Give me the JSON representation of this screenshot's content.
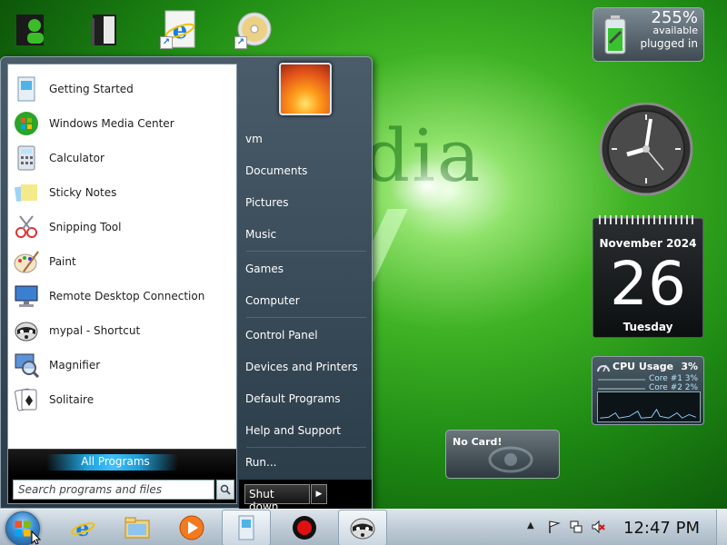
{
  "desktop": {
    "wallpaper_text": "dia",
    "icons": [
      {
        "name": "user-folder-icon"
      },
      {
        "name": "documents-folder-icon"
      },
      {
        "name": "internet-explorer-icon"
      },
      {
        "name": "dvd-drive-icon"
      }
    ]
  },
  "gadgets": {
    "battery": {
      "percent": "255%",
      "status": "available",
      "power": "plugged in"
    },
    "calendar": {
      "month": "November 2024",
      "day": "26",
      "weekday": "Tuesday"
    },
    "cpu": {
      "title": "CPU Usage",
      "total": "3%",
      "cores": [
        {
          "name": "Core #1",
          "value": "3%"
        },
        {
          "name": "Core #2",
          "value": "2%"
        }
      ]
    },
    "card": {
      "label": "No Card!"
    }
  },
  "start_menu": {
    "programs": [
      {
        "label": "Getting Started",
        "icon": "getting-started-icon"
      },
      {
        "label": "Windows Media Center",
        "icon": "media-center-icon"
      },
      {
        "label": "Calculator",
        "icon": "calculator-icon"
      },
      {
        "label": "Sticky Notes",
        "icon": "sticky-notes-icon"
      },
      {
        "label": "Snipping Tool",
        "icon": "snipping-tool-icon"
      },
      {
        "label": "Paint",
        "icon": "paint-icon"
      },
      {
        "label": "Remote Desktop Connection",
        "icon": "remote-desktop-icon"
      },
      {
        "label": "mypal - Shortcut",
        "icon": "mypal-icon"
      },
      {
        "label": "Magnifier",
        "icon": "magnifier-icon"
      },
      {
        "label": "Solitaire",
        "icon": "solitaire-icon"
      }
    ],
    "all_programs": "All Programs",
    "search_placeholder": "Search programs and files",
    "right_items": [
      {
        "label": "vm"
      },
      {
        "label": "Documents"
      },
      {
        "label": "Pictures"
      },
      {
        "label": "Music"
      },
      {
        "label": "Games"
      },
      {
        "label": "Computer"
      },
      {
        "label": "Control Panel"
      },
      {
        "label": "Devices and Printers"
      },
      {
        "label": "Default Programs"
      },
      {
        "label": "Help and Support"
      },
      {
        "label": "Run..."
      }
    ],
    "shutdown": "Shut down",
    "shutdown_arrow": "▶"
  },
  "taskbar": {
    "buttons": [
      {
        "name": "internet-explorer-icon"
      },
      {
        "name": "file-explorer-icon"
      },
      {
        "name": "media-player-icon"
      },
      {
        "name": "getting-started-icon"
      },
      {
        "name": "record-icon"
      },
      {
        "name": "mypal-icon"
      }
    ],
    "tray_show": "▲",
    "clock": "12:47 PM"
  }
}
